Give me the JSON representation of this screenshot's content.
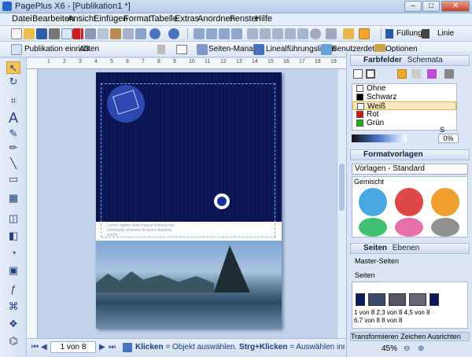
{
  "window": {
    "title": "PagePlus X6 - [Publikation1 *]",
    "min": "–",
    "max": "□",
    "close": "✕"
  },
  "menu": [
    "Datei",
    "Bearbeiten",
    "Ansicht",
    "Einfügen",
    "Format",
    "Tabelle",
    "Extras",
    "Anordnen",
    "Fenster",
    "Hilfe"
  ],
  "toolbar2": {
    "fill_label": "Füllung",
    "line_label": "Linie"
  },
  "toolbar3": {
    "setup": "Publikation einrichten",
    "size": "A3",
    "pages_manager": "Seiten-Manager",
    "ruler_lines": "Linealführungslinien",
    "user_details": "Benutzerdetails",
    "options": "Optionen"
  },
  "ruler": {
    "top": [
      "1",
      "2",
      "3",
      "4",
      "5",
      "6",
      "7",
      "8",
      "9",
      "10",
      "11",
      "12",
      "13",
      "14",
      "15",
      "16",
      "17",
      "18",
      "19"
    ]
  },
  "document": {
    "body_text": "Lorem sapien vitae massa rhoncus fau sollicitudin pharetra dictumst dapibus ipsum"
  },
  "status": {
    "page": "1 von 8",
    "hint_a": "Klicken",
    "hint_b": " = Objekt auswählen. ",
    "hint_c": "Strg+Klicken",
    "hint_d": " = Auswählen inn..."
  },
  "panels": {
    "swatches": {
      "tab_active": "Farbfelder",
      "tab_other": "Schemata",
      "items": [
        {
          "name": "Ohne",
          "color": "#ffffff"
        },
        {
          "name": "Schwarz",
          "color": "#000000"
        },
        {
          "name": "Weiß",
          "color": "#ffffff"
        },
        {
          "name": "Rot",
          "color": "#e31010"
        },
        {
          "name": "Grün",
          "color": "#17b517"
        }
      ],
      "tint_label": "S",
      "tint_value": "0%"
    },
    "styles": {
      "title": "Formatvorlagen",
      "dropdown": "Vorlagen - Standard",
      "category": "Gemischt",
      "gear_colors": [
        "#4aa8e0",
        "#e04848",
        "#f0a030",
        "#40c070",
        "#e870a8",
        "#909090"
      ]
    },
    "pages": {
      "tab_active": "Seiten",
      "tab_other": "Ebenen",
      "masters": "Master-Seiten",
      "pages_label": "Seiten",
      "thumb_labels": [
        "1 von 8",
        "2,3 von 8",
        "4,5 von 8",
        "6,7 von 8",
        "8 von 8"
      ]
    },
    "bottom_tabs": [
      "Transformieren",
      "Zeichen",
      "Ausrichten"
    ],
    "zoom": "45%"
  }
}
